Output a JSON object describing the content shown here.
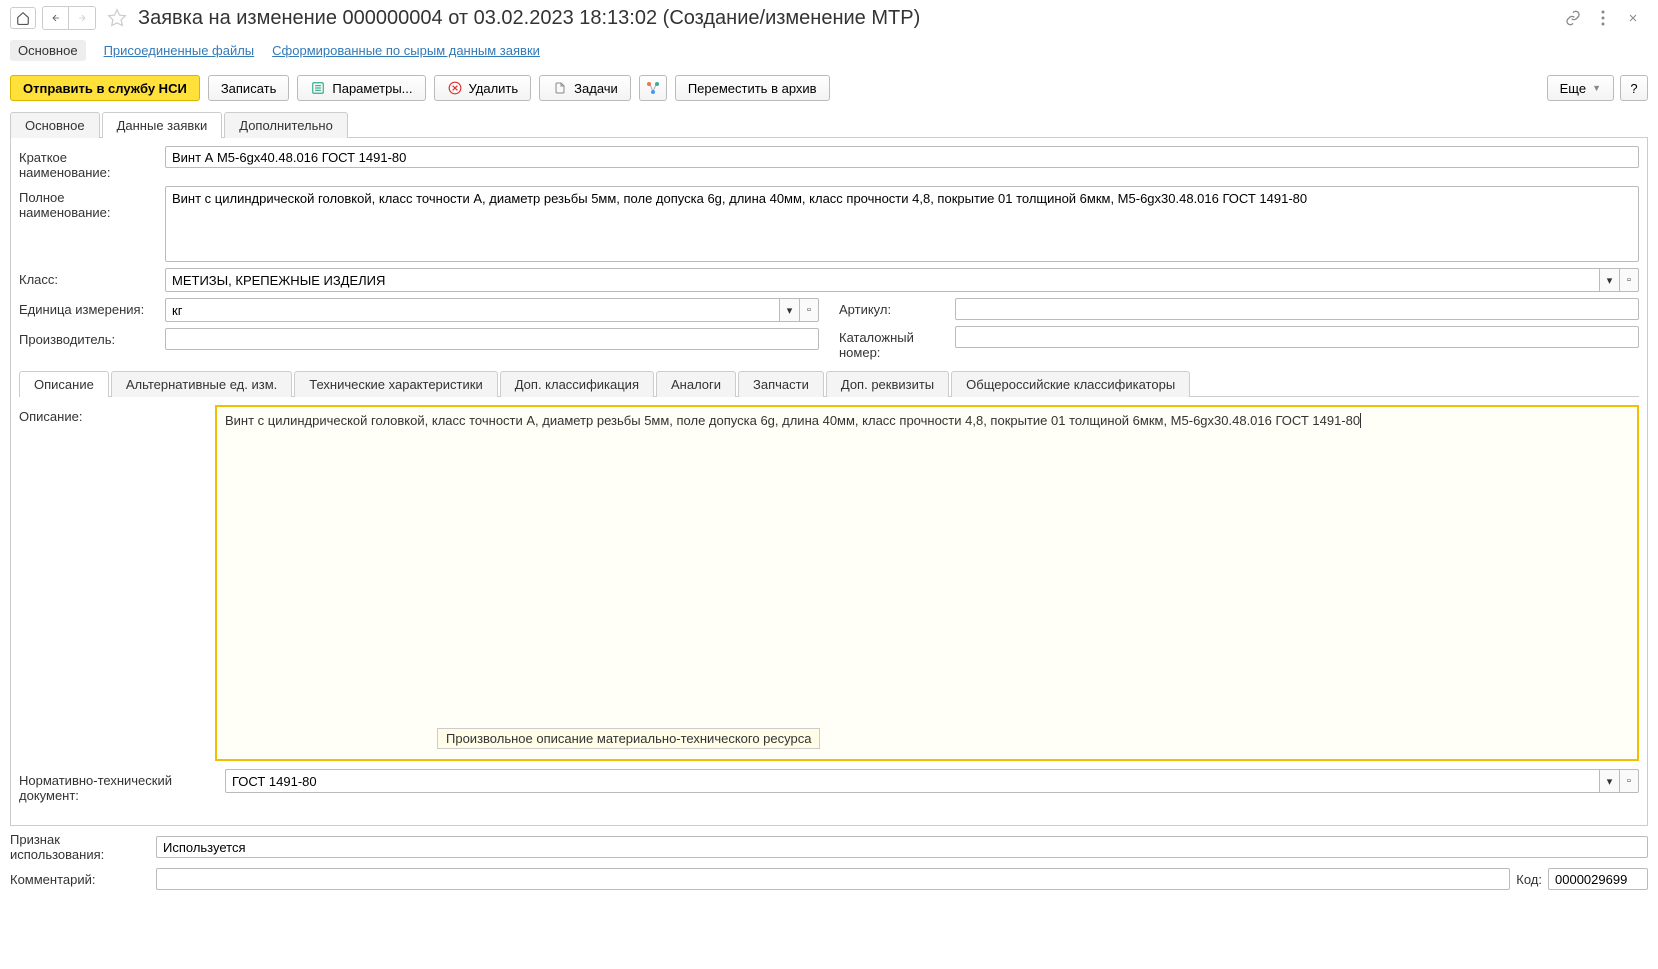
{
  "header": {
    "title": "Заявка на изменение 000000004 от 03.02.2023 18:13:02 (Создание/изменение МТР)"
  },
  "sectionLinks": {
    "main": "Основное",
    "files": "Присоединенные файлы",
    "raw": "Сформированные по сырым данным заявки"
  },
  "toolbar": {
    "send": "Отправить в службу НСИ",
    "save": "Записать",
    "params": "Параметры...",
    "delete": "Удалить",
    "tasks": "Задачи",
    "archive": "Переместить в архив",
    "more": "Еще"
  },
  "tabs": {
    "main": "Основное",
    "data": "Данные заявки",
    "extra": "Дополнительно"
  },
  "form": {
    "shortNameLabel": "Краткое наименование:",
    "shortName": "Винт А М5-6gх40.48.016 ГОСТ 1491-80",
    "fullNameLabel": "Полное наименование:",
    "fullName": "Винт с цилиндрической головкой, класс точности А, диаметр резьбы 5мм, поле допуска 6g, длина 40мм, класс прочности 4,8, покрытие 01 толщиной 6мкм, М5-6gх30.48.016 ГОСТ 1491-80",
    "classLabel": "Класс:",
    "class": "МЕТИЗЫ, КРЕПЕЖНЫЕ ИЗДЕЛИЯ",
    "unitLabel": "Единица измерения:",
    "unit": "кг",
    "articleLabel": "Артикул:",
    "article": "",
    "makerLabel": "Производитель:",
    "maker": "",
    "catalogLabel": "Каталожный номер:",
    "catalog": ""
  },
  "subtabs": {
    "desc": "Описание",
    "altUnits": "Альтернативные ед. изм.",
    "tech": "Технические характеристики",
    "classif": "Доп. классификация",
    "analogs": "Аналоги",
    "parts": "Запчасти",
    "req": "Доп. реквизиты",
    "okved": "Общероссийские классификаторы"
  },
  "desc": {
    "label": "Описание:",
    "text": "Винт с цилиндрической головкой, класс точности А, диаметр резьбы 5мм, поле допуска 6g, длина 40мм, класс прочности 4,8, покрытие 01 толщиной 6мкм, М5-6gх30.48.016 ГОСТ 1491-80",
    "tooltip": "Произвольное описание материально-технического ресурса",
    "ntdLabel": "Нормативно-технический документ:",
    "ntd": "ГОСТ 1491-80"
  },
  "footer": {
    "usageLabel": "Признак использования:",
    "usage": "Используется",
    "commentLabel": "Комментарий:",
    "comment": "",
    "codeLabel": "Код:",
    "code": "0000029699"
  }
}
